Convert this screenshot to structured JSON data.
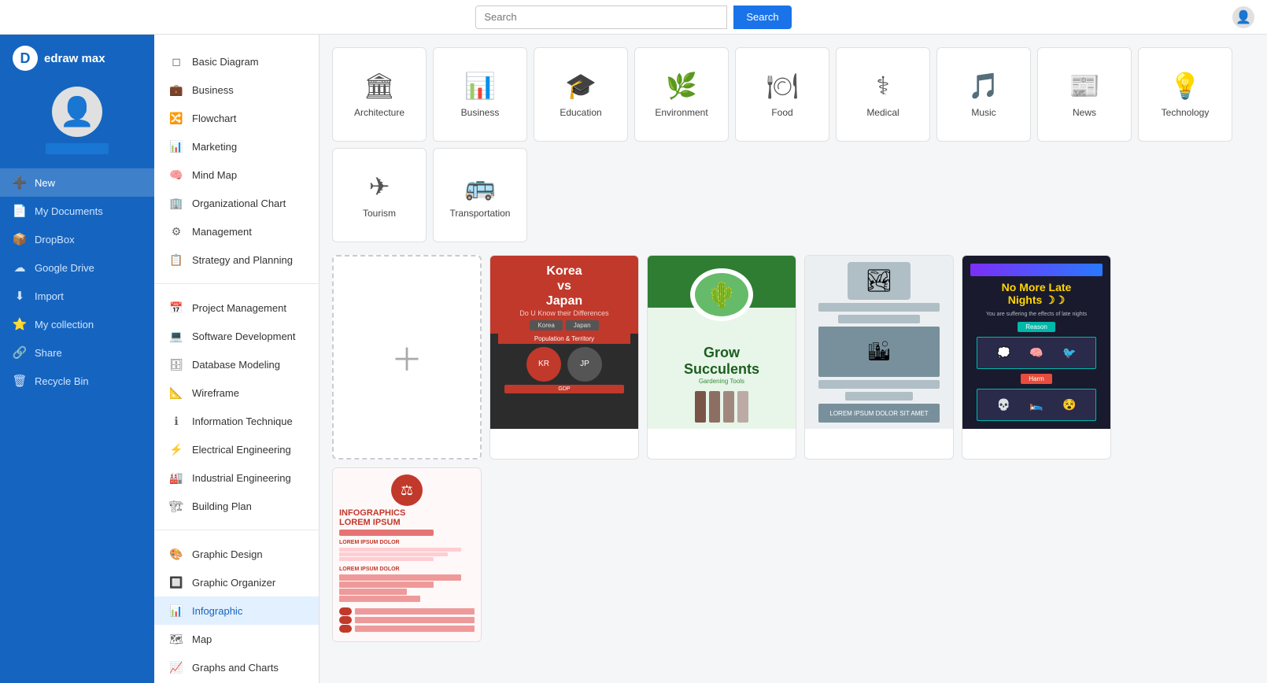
{
  "app": {
    "name": "edraw max",
    "logo_char": "D"
  },
  "topbar": {
    "search_placeholder": "Search",
    "search_button": "Search"
  },
  "sidebar": {
    "items": [
      {
        "id": "new",
        "label": "New",
        "icon": "➕",
        "active": true
      },
      {
        "id": "my-documents",
        "label": "My Documents",
        "icon": "📄"
      },
      {
        "id": "dropbox",
        "label": "DropBox",
        "icon": "📦"
      },
      {
        "id": "google-drive",
        "label": "Google Drive",
        "icon": "☁"
      },
      {
        "id": "import",
        "label": "Import",
        "icon": "⬇"
      },
      {
        "id": "my-collection",
        "label": "My collection",
        "icon": "⭐"
      },
      {
        "id": "share",
        "label": "Share",
        "icon": "🔗"
      },
      {
        "id": "recycle-bin",
        "label": "Recycle Bin",
        "icon": "🗑"
      }
    ]
  },
  "nav_panel": {
    "sections": [
      {
        "items": [
          {
            "label": "Basic Diagram",
            "icon": "◻"
          },
          {
            "label": "Business",
            "icon": "💼"
          },
          {
            "label": "Flowchart",
            "icon": "🔀"
          },
          {
            "label": "Marketing",
            "icon": "📊"
          },
          {
            "label": "Mind Map",
            "icon": "🧠"
          },
          {
            "label": "Organizational Chart",
            "icon": "🏢"
          },
          {
            "label": "Management",
            "icon": "⚙"
          },
          {
            "label": "Strategy and Planning",
            "icon": "📋"
          }
        ]
      },
      {
        "items": [
          {
            "label": "Project Management",
            "icon": "📅"
          },
          {
            "label": "Software Development",
            "icon": "💻"
          },
          {
            "label": "Database Modeling",
            "icon": "🗄"
          },
          {
            "label": "Wireframe",
            "icon": "📐"
          },
          {
            "label": "Information Technique",
            "icon": "ℹ"
          },
          {
            "label": "Electrical Engineering",
            "icon": "⚡"
          },
          {
            "label": "Industrial Engineering",
            "icon": "🏭"
          },
          {
            "label": "Building Plan",
            "icon": "🏗"
          }
        ]
      },
      {
        "items": [
          {
            "label": "Graphic Design",
            "icon": "🎨"
          },
          {
            "label": "Graphic Organizer",
            "icon": "🔲"
          },
          {
            "label": "Infographic",
            "icon": "📊",
            "active": true
          },
          {
            "label": "Map",
            "icon": "🗺"
          },
          {
            "label": "Graphs and Charts",
            "icon": "📈"
          }
        ]
      }
    ]
  },
  "categories": [
    {
      "label": "Architecture",
      "icon": "🏛"
    },
    {
      "label": "Business",
      "icon": "📊"
    },
    {
      "label": "Education",
      "icon": "🎓"
    },
    {
      "label": "Environment",
      "icon": "🌿"
    },
    {
      "label": "Food",
      "icon": "🍽"
    },
    {
      "label": "Medical",
      "icon": "⚕"
    },
    {
      "label": "Music",
      "icon": "🎵"
    },
    {
      "label": "News",
      "icon": "📰"
    },
    {
      "label": "Technology",
      "icon": "💡"
    },
    {
      "label": "Tourism",
      "icon": "✈"
    },
    {
      "label": "Transportation",
      "icon": "🚌"
    }
  ],
  "templates": [
    {
      "id": "new",
      "type": "new"
    },
    {
      "id": "korea-japan",
      "type": "korea-japan",
      "label": "Korea vs Japan"
    },
    {
      "id": "grow-succulents",
      "type": "green",
      "label": "Grow Succulents"
    },
    {
      "id": "blue-info",
      "type": "blue-infographic",
      "label": ""
    },
    {
      "id": "dark-nights",
      "type": "dark",
      "label": "No More Late Nights _ Reason"
    },
    {
      "id": "red-info",
      "type": "red-infographic",
      "label": "Infographics Lorem Ipsum"
    }
  ]
}
